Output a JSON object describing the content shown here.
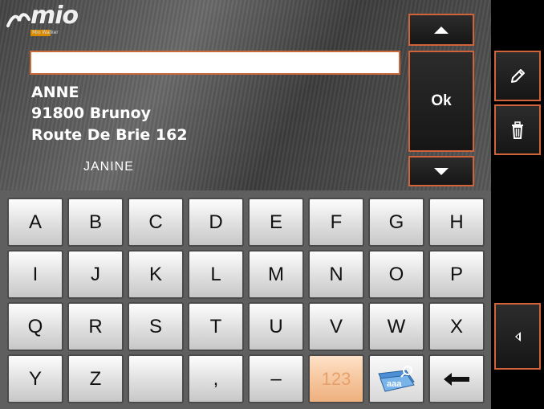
{
  "brand": {
    "logo_text": "mio",
    "logo_sub": "Mio Walker"
  },
  "search": {
    "value": ""
  },
  "result": {
    "name": "ANNE",
    "city": "91800 Brunoy",
    "street": "Route De Brie 162",
    "contact": "JANINE"
  },
  "buttons": {
    "ok_label": "Ok",
    "up_icon": "arrow-up-icon",
    "down_icon": "arrow-down-icon",
    "edit_icon": "pencil-icon",
    "delete_icon": "trash-icon",
    "back_icon": "arrow-left-icon"
  },
  "keyboard": {
    "row1": [
      "A",
      "B",
      "C",
      "D",
      "E",
      "F",
      "G",
      "H"
    ],
    "row2": [
      "I",
      "J",
      "K",
      "L",
      "M",
      "N",
      "O",
      "P"
    ],
    "row3": [
      "Q",
      "R",
      "S",
      "T",
      "U",
      "V",
      "W",
      "X"
    ],
    "row4": [
      "Y",
      "Z",
      "",
      ",",
      "–",
      "123",
      "",
      ""
    ],
    "mode_icon": "keyboard-layout-icon",
    "backspace_icon": "backspace-arrow-icon"
  },
  "colors": {
    "accent_border": "#d0633a",
    "key_face": "#e4e4e4",
    "numeric_key": "#f6c79f"
  }
}
